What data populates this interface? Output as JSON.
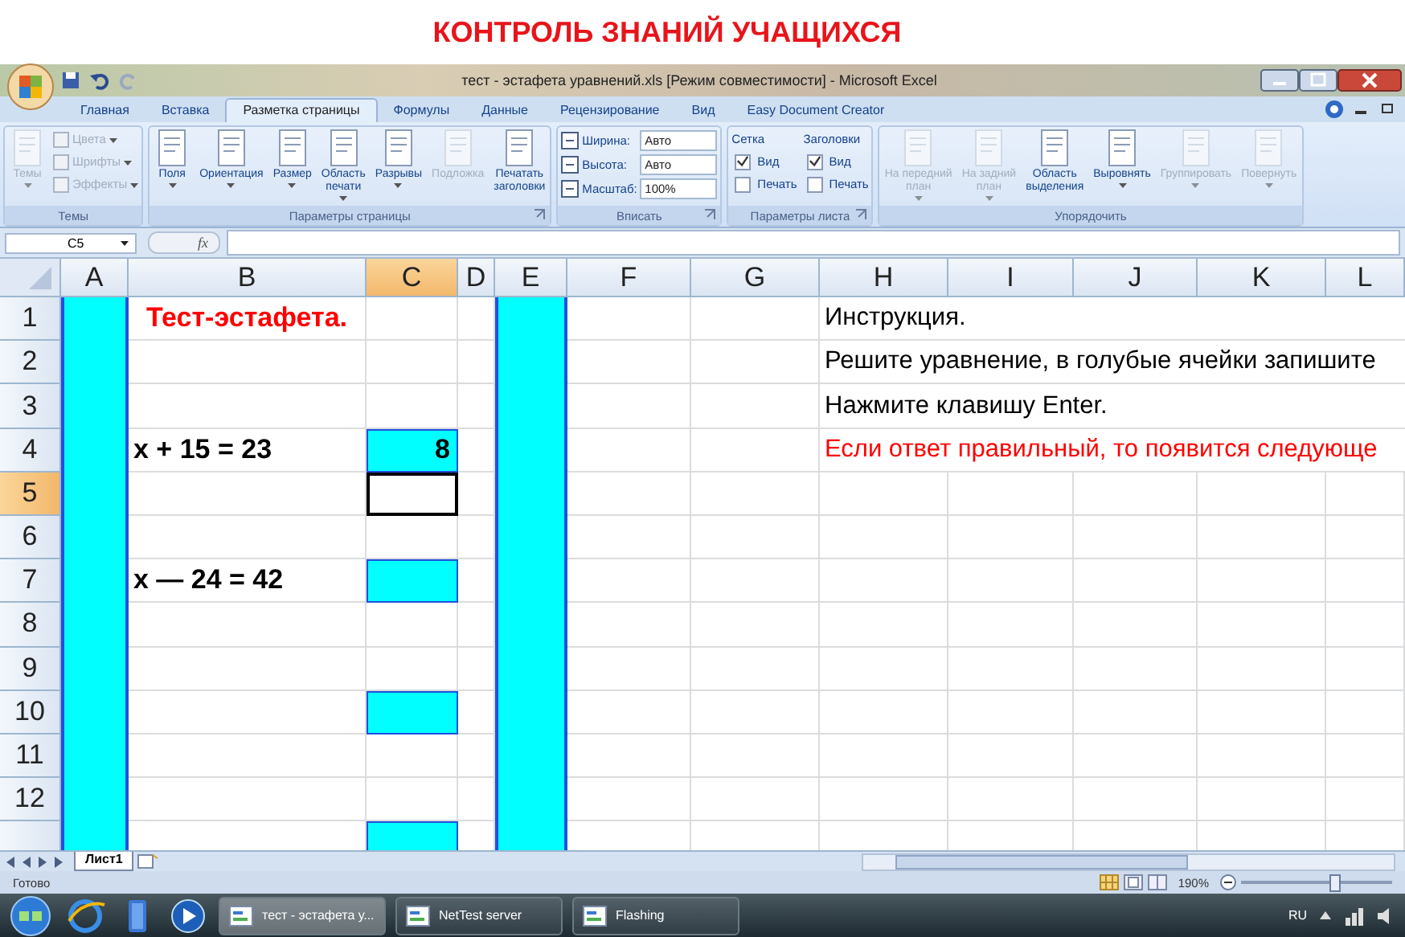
{
  "slide_title": "КОНТРОЛЬ ЗНАНИЙ УЧАЩИХСЯ",
  "window": {
    "title": "тест - эстафета уравнений.xls  [Режим совместимости] - Microsoft Excel"
  },
  "tabs": [
    {
      "label": "Главная",
      "selected": false
    },
    {
      "label": "Вставка",
      "selected": false
    },
    {
      "label": "Разметка страницы",
      "selected": true
    },
    {
      "label": "Формулы",
      "selected": false
    },
    {
      "label": "Данные",
      "selected": false
    },
    {
      "label": "Рецензирование",
      "selected": false
    },
    {
      "label": "Вид",
      "selected": false
    },
    {
      "label": "Easy Document Creator",
      "selected": false
    }
  ],
  "ribbon": [
    {
      "label": "Темы",
      "launcher": false,
      "items": [
        {
          "kind": "large",
          "label": "Темы",
          "disabled": true,
          "dropdown": true
        },
        {
          "kind": "small",
          "label": "Цвета",
          "disabled": true,
          "dropdown": true
        },
        {
          "kind": "small",
          "label": "Шрифты",
          "disabled": true,
          "dropdown": true
        },
        {
          "kind": "small",
          "label": "Эффекты",
          "disabled": true,
          "dropdown": true
        }
      ]
    },
    {
      "label": "Параметры страницы",
      "launcher": true,
      "items": [
        {
          "kind": "large",
          "label": "Поля",
          "disabled": false,
          "dropdown": true
        },
        {
          "kind": "large",
          "label": "Ориентация",
          "disabled": false,
          "dropdown": true
        },
        {
          "kind": "large",
          "label": "Размер",
          "disabled": false,
          "dropdown": true
        },
        {
          "kind": "large",
          "label": "Область\nпечати",
          "disabled": false,
          "dropdown": true
        },
        {
          "kind": "large",
          "label": "Разрывы",
          "disabled": false,
          "dropdown": true
        },
        {
          "kind": "large",
          "label": "Подложка",
          "disabled": true,
          "dropdown": false
        },
        {
          "kind": "large",
          "label": "Печатать\nзаголовки",
          "disabled": false,
          "dropdown": false
        }
      ]
    },
    {
      "label": "Вписать",
      "launcher": true,
      "items": [
        {
          "kind": "field",
          "label": "Ширина:",
          "value": "Авто"
        },
        {
          "kind": "field",
          "label": "Высота:",
          "value": "Авто"
        },
        {
          "kind": "field",
          "label": "Масштаб:",
          "value": "100%"
        }
      ]
    },
    {
      "label": "Параметры листа",
      "launcher": true,
      "items": [
        {
          "kind": "heading",
          "label": "Сетка"
        },
        {
          "kind": "check",
          "label": "Вид",
          "checked": true
        },
        {
          "kind": "check",
          "label": "Печать",
          "checked": false
        },
        {
          "kind": "heading",
          "label": "Заголовки"
        },
        {
          "kind": "check",
          "label": "Вид",
          "checked": true
        },
        {
          "kind": "check",
          "label": "Печать",
          "checked": false
        }
      ]
    },
    {
      "label": "Упорядочить",
      "launcher": false,
      "items": [
        {
          "kind": "large",
          "label": "На передний\nплан",
          "disabled": true,
          "dropdown": true
        },
        {
          "kind": "large",
          "label": "На задний\nплан",
          "disabled": true,
          "dropdown": true
        },
        {
          "kind": "large",
          "label": "Область\nвыделения",
          "disabled": false,
          "dropdown": false
        },
        {
          "kind": "large",
          "label": "Выровнять",
          "disabled": false,
          "dropdown": true
        },
        {
          "kind": "large",
          "label": "Группировать",
          "disabled": true,
          "dropdown": true
        },
        {
          "kind": "large",
          "label": "Повернуть",
          "disabled": true,
          "dropdown": true
        }
      ]
    }
  ],
  "formula_bar": {
    "name_box": "C5",
    "function_label": "fx"
  },
  "columns": [
    {
      "label": "A",
      "selected": false
    },
    {
      "label": "B",
      "selected": false
    },
    {
      "label": "C",
      "selected": true
    },
    {
      "label": "D",
      "selected": false
    },
    {
      "label": "E",
      "selected": false
    },
    {
      "label": "F",
      "selected": false
    },
    {
      "label": "G",
      "selected": false
    },
    {
      "label": "H",
      "selected": false
    },
    {
      "label": "I",
      "selected": false
    },
    {
      "label": "J",
      "selected": false
    },
    {
      "label": "K",
      "selected": false
    },
    {
      "label": "L",
      "selected": false
    }
  ],
  "rows": [
    {
      "number": "1",
      "selected": false,
      "cells": [
        {
          "kind": "cyan"
        },
        {
          "kind": "title",
          "text": "Тест-эстафета."
        },
        {
          "kind": "plain"
        },
        {
          "kind": "plain"
        },
        {
          "kind": "cyan"
        },
        {
          "kind": "plain"
        },
        {
          "kind": "plain"
        },
        {
          "kind": "note",
          "text": "Инструкция."
        }
      ]
    },
    {
      "number": "2",
      "selected": false,
      "cells": [
        {
          "kind": "cyan"
        },
        {
          "kind": "plain"
        },
        {
          "kind": "plain"
        },
        {
          "kind": "plain"
        },
        {
          "kind": "cyan"
        },
        {
          "kind": "plain"
        },
        {
          "kind": "plain"
        },
        {
          "kind": "note",
          "text": "Решите уравнение, в голубые ячейки запишите"
        }
      ]
    },
    {
      "number": "3",
      "selected": false,
      "cells": [
        {
          "kind": "cyan"
        },
        {
          "kind": "plain"
        },
        {
          "kind": "plain"
        },
        {
          "kind": "plain"
        },
        {
          "kind": "cyan"
        },
        {
          "kind": "plain"
        },
        {
          "kind": "plain"
        },
        {
          "kind": "note",
          "text": "Нажмите клавишу Enter."
        }
      ]
    },
    {
      "number": "4",
      "selected": false,
      "cells": [
        {
          "kind": "cyan"
        },
        {
          "kind": "equation",
          "text": "x + 15 = 23"
        },
        {
          "kind": "answer",
          "text": "8"
        },
        {
          "kind": "plain"
        },
        {
          "kind": "cyan"
        },
        {
          "kind": "plain"
        },
        {
          "kind": "plain"
        },
        {
          "kind": "alert",
          "text": "Если ответ правильный, то появится следующе"
        }
      ]
    },
    {
      "number": "5",
      "selected": true,
      "cells": [
        {
          "kind": "cyan"
        },
        {
          "kind": "plain"
        },
        {
          "kind": "active"
        },
        {
          "kind": "plain"
        },
        {
          "kind": "cyan"
        }
      ]
    },
    {
      "number": "6",
      "selected": false,
      "cells": [
        {
          "kind": "cyan"
        },
        {
          "kind": "plain"
        },
        {
          "kind": "plain"
        },
        {
          "kind": "plain"
        },
        {
          "kind": "cyan"
        }
      ]
    },
    {
      "number": "7",
      "selected": false,
      "cells": [
        {
          "kind": "cyan"
        },
        {
          "kind": "equation",
          "text": "x — 24 = 42"
        },
        {
          "kind": "answer"
        },
        {
          "kind": "plain"
        },
        {
          "kind": "cyan"
        }
      ]
    },
    {
      "number": "8",
      "selected": false,
      "cells": [
        {
          "kind": "cyan"
        },
        {
          "kind": "plain"
        },
        {
          "kind": "plain"
        },
        {
          "kind": "plain"
        },
        {
          "kind": "cyan"
        }
      ]
    },
    {
      "number": "9",
      "selected": false,
      "cells": [
        {
          "kind": "cyan"
        },
        {
          "kind": "plain"
        },
        {
          "kind": "plain"
        },
        {
          "kind": "plain"
        },
        {
          "kind": "cyan"
        }
      ]
    },
    {
      "number": "10",
      "selected": false,
      "cells": [
        {
          "kind": "cyan"
        },
        {
          "kind": "plain"
        },
        {
          "kind": "answer"
        },
        {
          "kind": "plain"
        },
        {
          "kind": "cyan"
        }
      ]
    },
    {
      "number": "11",
      "selected": false,
      "cells": [
        {
          "kind": "cyan"
        },
        {
          "kind": "plain"
        },
        {
          "kind": "plain"
        },
        {
          "kind": "plain"
        },
        {
          "kind": "cyan"
        }
      ]
    },
    {
      "number": "12",
      "selected": false,
      "cells": [
        {
          "kind": "cyan"
        },
        {
          "kind": "plain"
        },
        {
          "kind": "plain"
        },
        {
          "kind": "plain"
        },
        {
          "kind": "cyan"
        }
      ]
    },
    {
      "selected": false,
      "cells": [
        {
          "kind": "cyan"
        },
        {
          "kind": "plain"
        },
        {
          "kind": "answer"
        },
        {
          "kind": "plain"
        },
        {
          "kind": "cyan"
        }
      ]
    }
  ],
  "sheet_tabs": [
    {
      "label": "Лист1",
      "selected": true
    }
  ],
  "status_bar": {
    "text": "Готово",
    "zoom": "190%",
    "zoom_slider": {
      "level": 0.62
    }
  },
  "taskbar": {
    "tasks": [
      {
        "label": "тест - эстафета у...",
        "selected": true
      },
      {
        "label": "NetTest server",
        "selected": false
      },
      {
        "label": "Flashing",
        "selected": false
      }
    ],
    "language": "RU"
  }
}
